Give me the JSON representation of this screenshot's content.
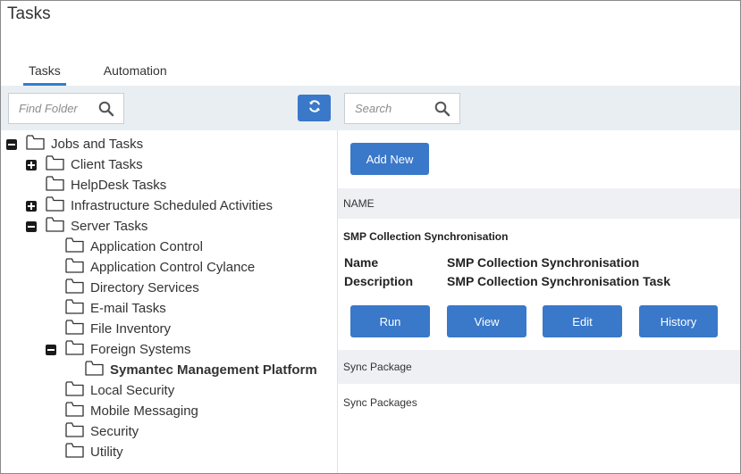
{
  "page": {
    "title": "Tasks"
  },
  "tabs": [
    {
      "label": "Tasks",
      "active": true
    },
    {
      "label": "Automation",
      "active": false
    }
  ],
  "toolbar": {
    "find_folder_placeholder": "Find Folder",
    "search_placeholder": "Search",
    "accent_color": "#3a78c9"
  },
  "tree": [
    {
      "label": "Jobs and Tasks",
      "toggle": "minus"
    },
    {
      "label": "Client Tasks",
      "toggle": "plus"
    },
    {
      "label": "HelpDesk Tasks",
      "toggle": null
    },
    {
      "label": "Infrastructure Scheduled Activities",
      "toggle": "plus"
    },
    {
      "label": "Server Tasks",
      "toggle": "minus"
    },
    {
      "label": "Application Control",
      "toggle": null
    },
    {
      "label": "Application Control Cylance",
      "toggle": null
    },
    {
      "label": "Directory Services",
      "toggle": null
    },
    {
      "label": "E-mail Tasks",
      "toggle": null
    },
    {
      "label": "File Inventory",
      "toggle": null
    },
    {
      "label": "Foreign Systems",
      "toggle": "minus"
    },
    {
      "label": "Symantec Management Platform",
      "toggle": null,
      "selected": true
    },
    {
      "label": "Local Security",
      "toggle": null
    },
    {
      "label": "Mobile Messaging",
      "toggle": null
    },
    {
      "label": "Security",
      "toggle": null
    },
    {
      "label": "Utility",
      "toggle": null
    }
  ],
  "main": {
    "add_new_label": "Add New",
    "column_header": "NAME",
    "task": {
      "title": "SMP Collection Synchronisation",
      "name_label": "Name",
      "name_value": "SMP Collection Synchronisation",
      "description_label": "Description",
      "description_value": "SMP Collection Synchronisation Task"
    },
    "actions": [
      "Run",
      "View",
      "Edit",
      "History"
    ],
    "rows": [
      "Sync Package",
      "Sync Packages"
    ]
  }
}
